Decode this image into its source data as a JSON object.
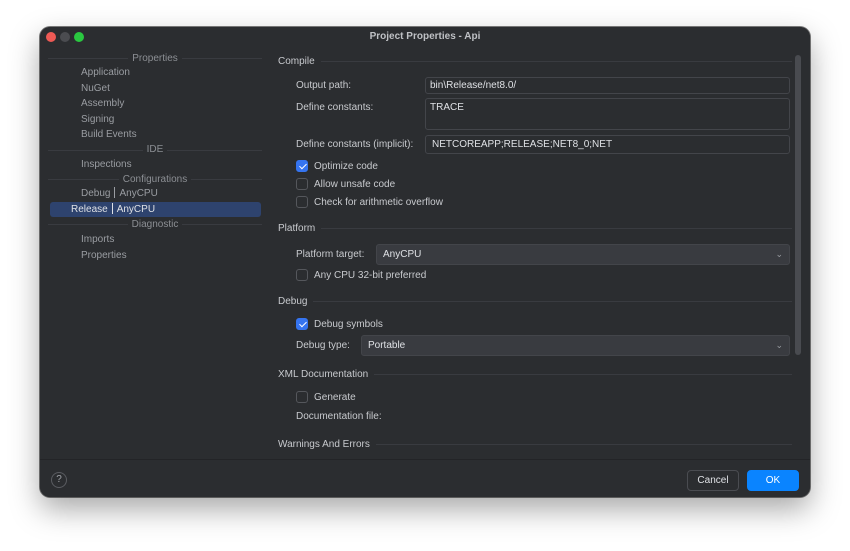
{
  "window": {
    "title": "Project Properties - Api",
    "traffic_lights": [
      "close",
      "minimize",
      "maximize"
    ]
  },
  "sidebar": {
    "sections": [
      {
        "title": "Properties",
        "items": [
          "Application",
          "NuGet",
          "Assembly",
          "Signing",
          "Build Events"
        ]
      },
      {
        "title": "IDE",
        "items": [
          "Inspections"
        ]
      },
      {
        "title": "Configurations",
        "items": [
          {
            "config": "Debug",
            "platform": "AnyCPU",
            "selected": false
          },
          {
            "config": "Release",
            "platform": "AnyCPU",
            "selected": true
          }
        ]
      },
      {
        "title": "Diagnostic",
        "items": [
          "Imports",
          "Properties"
        ]
      }
    ]
  },
  "main": {
    "compile": {
      "title": "Compile",
      "output_path_label": "Output path:",
      "output_path_value": "bin\\Release/net8.0/",
      "define_constants_label": "Define constants:",
      "define_constants_value": "TRACE",
      "define_implicit_label": "Define constants (implicit):",
      "define_implicit_value": "NETCOREAPP;RELEASE;NET8_0;NET",
      "optimize_label": "Optimize code",
      "optimize_checked": true,
      "unsafe_label": "Allow unsafe code",
      "unsafe_checked": false,
      "overflow_label": "Check for arithmetic overflow",
      "overflow_checked": false
    },
    "platform": {
      "title": "Platform",
      "target_label": "Platform target:",
      "target_value": "AnyCPU",
      "prefer32_label": "Any CPU 32-bit preferred",
      "prefer32_checked": false
    },
    "debug": {
      "title": "Debug",
      "symbols_label": "Debug symbols",
      "symbols_checked": true,
      "type_label": "Debug type:",
      "type_value": "Portable"
    },
    "xml_doc": {
      "title": "XML Documentation",
      "generate_label": "Generate",
      "generate_checked": false,
      "file_label": "Documentation file:"
    },
    "warnings": {
      "title": "Warnings And Errors"
    }
  },
  "footer": {
    "help_label": "?",
    "cancel_label": "Cancel",
    "ok_label": "OK"
  },
  "icons": {
    "chevron": "⌄",
    "help": "?"
  },
  "colors": {
    "accent": "#0a84ff",
    "checkbox_on": "#3574f0",
    "selection": "#2e436e",
    "window_bg": "#2b2d30"
  }
}
